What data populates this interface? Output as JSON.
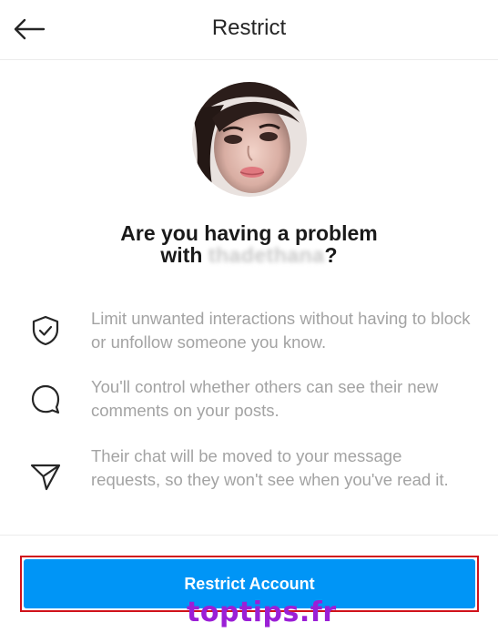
{
  "header": {
    "title": "Restrict",
    "back_icon": "arrow-left-icon"
  },
  "headline": {
    "line1": "Are you having a problem",
    "line2_prefix": "with",
    "blurred_username": "thadethana",
    "line2_suffix": "?"
  },
  "info_items": [
    {
      "icon": "shield-check-icon",
      "text": "Limit unwanted interactions without having to block or unfollow someone you know."
    },
    {
      "icon": "comment-bubble-icon",
      "text": "You'll control whether others can see their new comments on your posts."
    },
    {
      "icon": "paper-plane-icon",
      "text": "Their chat will be moved to your message requests, so they won't see when you've read it."
    }
  ],
  "cta": {
    "label": "Restrict Account",
    "color": "#0095f6",
    "highlight_color": "#d0121b"
  },
  "watermark": "toptips.fr"
}
